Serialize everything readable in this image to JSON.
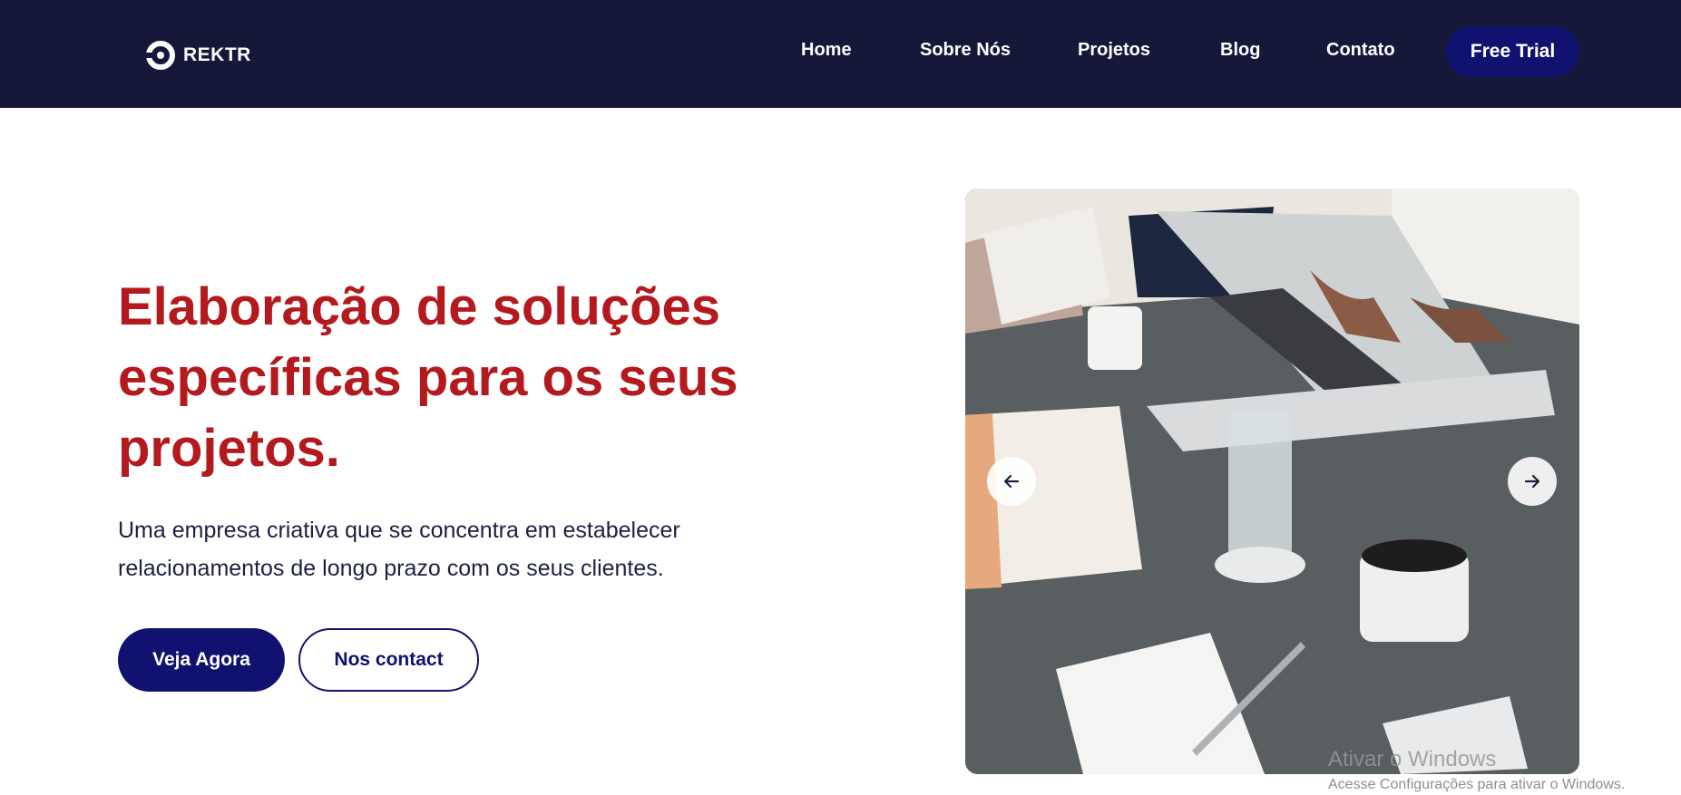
{
  "brand": {
    "name": "REKTR"
  },
  "nav": {
    "items": [
      {
        "label": "Home"
      },
      {
        "label": "Sobre Nós"
      },
      {
        "label": "Projetos"
      },
      {
        "label": "Blog"
      },
      {
        "label": "Contato"
      }
    ],
    "cta_label": "Free Trial"
  },
  "hero": {
    "title": "Elaboração de soluções específicas para os seus projetos.",
    "description": "Uma empresa criativa que se concentra em estabelecer relacionamentos de longo prazo com os seus clientes.",
    "primary_button": "Veja Agora",
    "secondary_button": "Nos contact"
  },
  "slider": {
    "prev_icon": "arrow-left-icon",
    "next_icon": "arrow-right-icon"
  },
  "windows_watermark": {
    "title": "Ativar o Windows",
    "subtitle": "Acesse Configurações para ativar o Windows."
  },
  "colors": {
    "nav_bg": "#16183a",
    "primary": "#111270",
    "heading": "#b3191d",
    "text": "#1d2040"
  }
}
